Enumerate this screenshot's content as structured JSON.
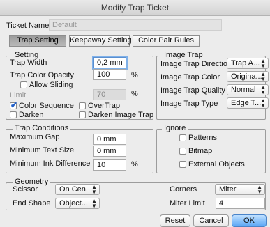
{
  "window": {
    "title": "Modify Trap Ticket"
  },
  "ticket": {
    "name_label": "Ticket Name",
    "name_placeholder": "Default"
  },
  "tabs": [
    "Trap Setting",
    "Keepaway Setting",
    "Color Pair Rules"
  ],
  "setting": {
    "title": "Setting",
    "trap_width_label": "Trap Width",
    "trap_width_value": "0,2 mm",
    "trap_color_opacity_label": "Trap Color Opacity",
    "trap_color_opacity_value": "100",
    "percent": "%",
    "allow_sliding_label": "Allow Sliding",
    "limit_label": "Limit",
    "limit_value": "70",
    "color_sequence_label": "Color Sequence",
    "overtrap_label": "OverTrap",
    "darken_label": "Darken",
    "darken_image_trap_label": "Darken Image Trap"
  },
  "image_trap": {
    "title": "Image Trap",
    "direction_label": "Image Trap Direction",
    "direction_value": "Trap A...",
    "color_label": "Image Trap Color",
    "color_value": "Origina...",
    "quality_label": "Image Trap Quality",
    "quality_value": "Normal",
    "type_label": "Image Trap Type",
    "type_value": "Edge T..."
  },
  "trap_conditions": {
    "title": "Trap Conditions",
    "max_gap_label": "Maximum Gap",
    "max_gap_value": "0 mm",
    "min_text_label": "Minimum Text Size",
    "min_text_value": "0 mm",
    "min_ink_label": "Minimum Ink Difference",
    "min_ink_value": "10",
    "percent": "%"
  },
  "ignore": {
    "title": "Ignore",
    "patterns_label": "Patterns",
    "bitmap_label": "Bitmap",
    "external_objects_label": "External Objects"
  },
  "geometry": {
    "title": "Geometry",
    "scissor_label": "Scissor",
    "scissor_value": "On Cen...",
    "end_shape_label": "End Shape",
    "end_shape_value": "Object...",
    "corners_label": "Corners",
    "corners_value": "Miter",
    "miter_limit_label": "Miter Limit",
    "miter_limit_value": "4"
  },
  "buttons": {
    "reset": "Reset",
    "cancel": "Cancel",
    "ok": "OK"
  },
  "icons": {
    "popup_arrows": "⬍",
    "checkmark": "✔"
  },
  "colors": {
    "accent": "#5aa6f5",
    "focus_ring": "#7fb0e8",
    "background": "#ececec"
  }
}
